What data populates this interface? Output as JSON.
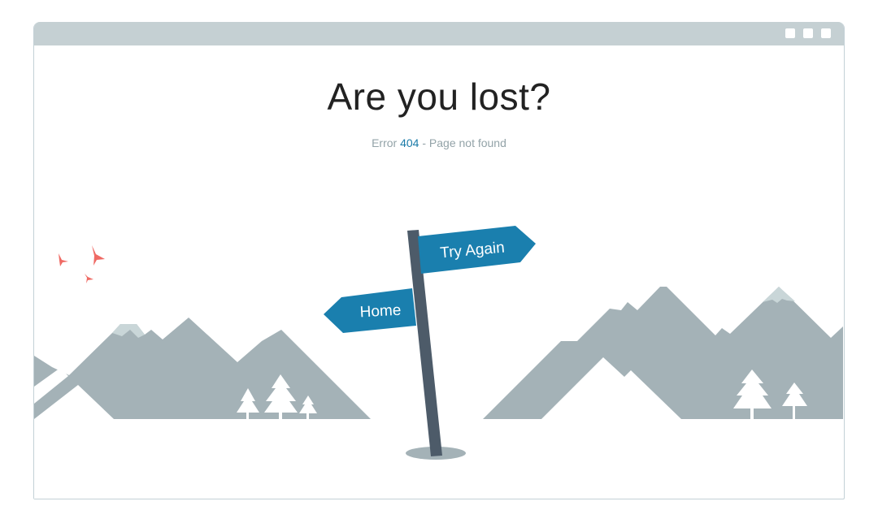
{
  "window": {
    "controls": [
      "window-button",
      "window-button",
      "window-button"
    ]
  },
  "content": {
    "headline": "Are you lost?",
    "error_prefix": "Error",
    "error_code": "404",
    "error_suffix": "- Page not found"
  },
  "signpost": {
    "try_again_label": "Try Again",
    "home_label": "Home"
  },
  "colors": {
    "mountain": "#a4b2b7",
    "snowcap": "#c9d6d8",
    "sign": "#1a7fae",
    "post": "#4d5b69",
    "birds": "#ef6a64",
    "titlebar": "#c5d0d3",
    "accent": "#1a7ba8"
  }
}
